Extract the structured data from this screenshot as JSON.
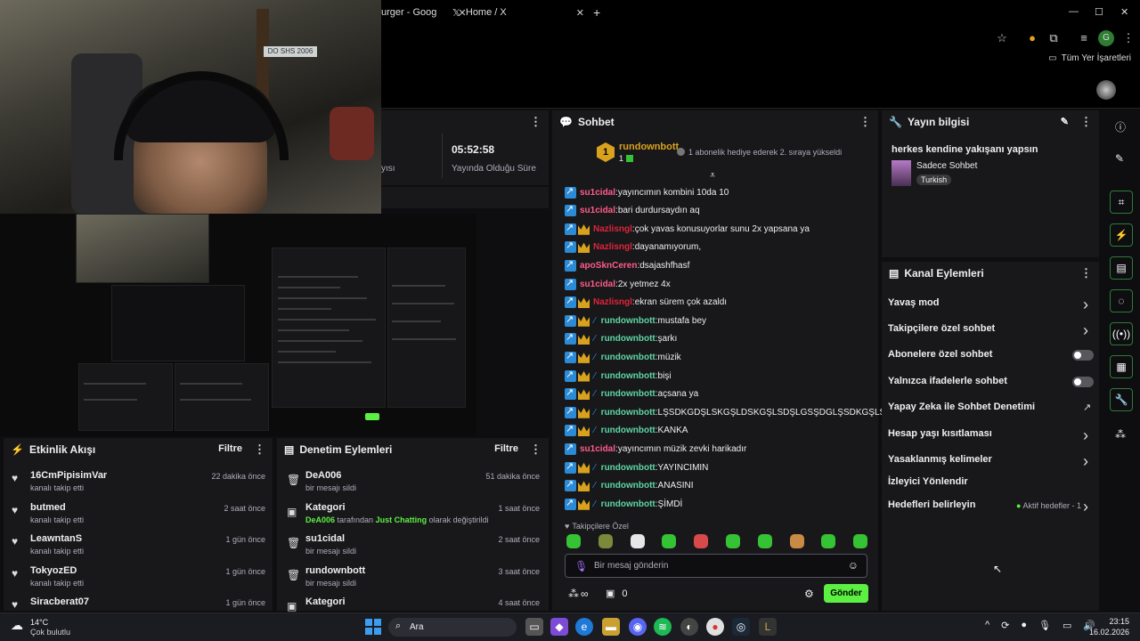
{
  "browser": {
    "tabs": [
      {
        "label": "urger - Goog",
        "close": "✕"
      },
      {
        "label": "Home / X",
        "close": "✕"
      }
    ],
    "new_tab": "+",
    "window_controls": [
      "—",
      "☐",
      "✕"
    ],
    "bookmarks_label": "Tüm Yer İşaretleri",
    "profile_letter": "G"
  },
  "webcam": {
    "sign_text": "DO SHS 2006"
  },
  "stats_panel": {
    "time_value": "05:52:58",
    "time_label": "Yayında Olduğu Süre",
    "cut_label": "yısı"
  },
  "chat": {
    "title": "Sohbet",
    "pinned": {
      "rank": "1",
      "user": "rundownbott",
      "count": "1",
      "text": "1 abonelik hediye ederek 2. sıraya yükseldi"
    },
    "messages": [
      {
        "user": "su1cidal",
        "color": "#ff5c8a",
        "badges": [
          "blue"
        ],
        "text": "yayıncımın kombini 10da 10"
      },
      {
        "user": "su1cidal",
        "color": "#ff5c8a",
        "badges": [
          "blue"
        ],
        "text": "bari durdursaydın aq"
      },
      {
        "user": "Nazlisngl",
        "color": "#e0243a",
        "badges": [
          "blue",
          "crown"
        ],
        "text": "çok yavas konusuyorlar sunu 2x yapsana ya"
      },
      {
        "user": "Nazlisngl",
        "color": "#e0243a",
        "badges": [
          "blue",
          "crown"
        ],
        "text": "dayanamıyorum,"
      },
      {
        "user": "apoSknCeren",
        "color": "#ff5c8a",
        "badges": [
          "blue"
        ],
        "text": "dsajashfhasf"
      },
      {
        "user": "su1cidal",
        "color": "#ff5c8a",
        "badges": [
          "blue"
        ],
        "text": "2x yetmez 4x"
      },
      {
        "user": "Nazlisngl",
        "color": "#e0243a",
        "badges": [
          "blue",
          "crown"
        ],
        "text": "ekran sürem çok azaldı"
      },
      {
        "user": "rundownbott",
        "color": "#5fd6a5",
        "badges": [
          "blue",
          "crown",
          "pen"
        ],
        "text": "mustafa bey"
      },
      {
        "user": "rundownbott",
        "color": "#5fd6a5",
        "badges": [
          "blue",
          "crown",
          "pen"
        ],
        "text": "şarkı"
      },
      {
        "user": "rundownbott",
        "color": "#5fd6a5",
        "badges": [
          "blue",
          "crown",
          "pen"
        ],
        "text": "müzik"
      },
      {
        "user": "rundownbott",
        "color": "#5fd6a5",
        "badges": [
          "blue",
          "crown",
          "pen"
        ],
        "text": "bişi"
      },
      {
        "user": "rundownbott",
        "color": "#5fd6a5",
        "badges": [
          "blue",
          "crown",
          "pen"
        ],
        "text": "açsana ya"
      },
      {
        "user": "rundownbott",
        "color": "#5fd6a5",
        "badges": [
          "blue",
          "crown",
          "pen"
        ],
        "text": "LŞSDKGDŞLSKGŞLDSKGŞLSDŞLGSŞDGLŞSDKGŞLSD"
      },
      {
        "user": "rundownbott",
        "color": "#5fd6a5",
        "badges": [
          "blue",
          "crown",
          "pen"
        ],
        "text": "KANKA"
      },
      {
        "user": "su1cidal",
        "color": "#ff5c8a",
        "badges": [
          "blue"
        ],
        "text": "yayıncımın müzik zevki harikadır"
      },
      {
        "user": "rundownbott",
        "color": "#5fd6a5",
        "badges": [
          "blue",
          "crown",
          "pen"
        ],
        "text": "YAYINCIMIN"
      },
      {
        "user": "rundownbott",
        "color": "#5fd6a5",
        "badges": [
          "blue",
          "crown",
          "pen"
        ],
        "text": "ANASINI"
      },
      {
        "user": "rundownbott",
        "color": "#5fd6a5",
        "badges": [
          "blue",
          "crown",
          "pen"
        ],
        "text": "ŞİMDİ"
      }
    ],
    "followers_only": "Takipçilere Özel",
    "input_placeholder": "Bir mesaj gönderin",
    "points": "0",
    "infinity": "∞",
    "send_label": "Gönder"
  },
  "stream_info": {
    "title": "Yayın bilgisi",
    "stream_title": "herkes kendine yakışanı yapsın",
    "category": "Sadece Sohbet",
    "tag": "Turkish"
  },
  "channel_actions": {
    "title": "Kanal Eylemleri",
    "items": [
      {
        "label": "Yavaş mod",
        "control": "chevron"
      },
      {
        "label": "Takipçilere özel sohbet",
        "control": "chevron"
      },
      {
        "label": "Abonelere özel sohbet",
        "control": "toggle"
      },
      {
        "label": "Yalnızca ifadelerle sohbet",
        "control": "toggle"
      },
      {
        "label": "Yapay Zeka ile Sohbet Denetimi",
        "control": "external"
      },
      {
        "label": "Hesap yaşı kısıtlaması",
        "control": "chevron"
      },
      {
        "label": "Yasaklanmış kelimeler",
        "control": "chevron"
      },
      {
        "label": "İzleyici Yönlendir",
        "control": "none"
      },
      {
        "label": "Hedefleri belirleyin",
        "control": "chevron",
        "note": "Aktif hedefler - 1"
      }
    ]
  },
  "activity": {
    "title": "Etkinlik Akışı",
    "filter": "Filtre",
    "rows": [
      {
        "name": "16CmPipisimVar",
        "sub": "kanalı takip etti",
        "time": "22 dakika önce"
      },
      {
        "name": "butmed",
        "sub": "kanalı takip etti",
        "time": "2 saat önce"
      },
      {
        "name": "LeawntanS",
        "sub": "kanalı takip etti",
        "time": "1 gün önce"
      },
      {
        "name": "TokyozED",
        "sub": "kanalı takip etti",
        "time": "1 gün önce"
      },
      {
        "name": "Siracberat07",
        "sub": "",
        "time": "1 gün önce"
      }
    ]
  },
  "moderation": {
    "title": "Denetim Eylemleri",
    "filter": "Filtre",
    "rows": [
      {
        "name": "DeA006",
        "sub": "bir mesajı sildi",
        "time": "51 dakika önce",
        "icon": "trash"
      },
      {
        "name": "Kategori",
        "sub_user": "DeA006",
        "sub_mid": " tarafından ",
        "sub_cat": "Just Chatting",
        "sub_end": " olarak değiştirildi",
        "time": "1 saat önce",
        "icon": "category"
      },
      {
        "name": "su1cidal",
        "sub": "bir mesajı sildi",
        "time": "2 saat önce",
        "icon": "trash"
      },
      {
        "name": "rundownbott",
        "sub": "bir mesajı sildi",
        "time": "3 saat önce",
        "icon": "trash"
      },
      {
        "name": "Kategori",
        "sub": "",
        "time": "4 saat önce",
        "icon": "category"
      }
    ]
  },
  "taskbar": {
    "weather_temp": "14°C",
    "weather_desc": "Çok bulutlu",
    "search_label": "Ara",
    "time": "23:15",
    "date": "16.02.2026"
  },
  "colors": {
    "accent_green": "#5cf042",
    "twitch_bg": "#18181b",
    "crown": "#d9a21e"
  }
}
